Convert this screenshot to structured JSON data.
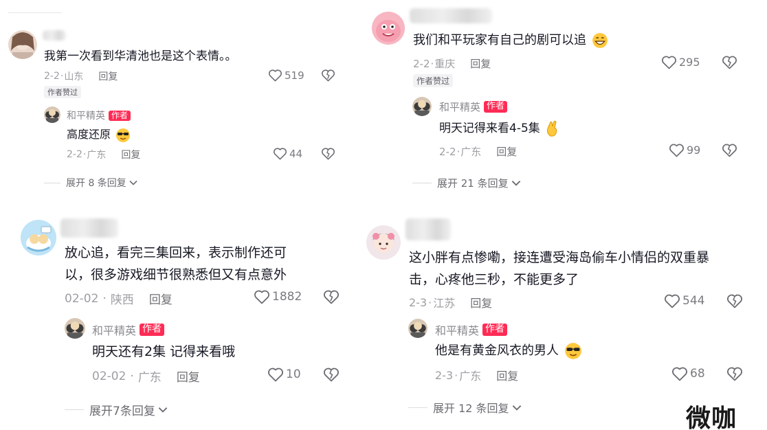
{
  "comments": [
    {
      "text_lines": [
        "我第一次看到华清池也是这个表情。。"
      ],
      "date": "2-2",
      "sep": "·",
      "location": "山东",
      "reply_label": "回复",
      "likes": "519",
      "tag": "作者赞过",
      "reply": {
        "name": "和平精英",
        "badge": "作者",
        "text": "高度还原",
        "date": "2-2",
        "sep": "·",
        "location": "广东",
        "reply_label": "回复",
        "likes": "44"
      },
      "expand": "展开 8 条回复"
    },
    {
      "text_lines": [
        "我们和平玩家有自己的剧可以追"
      ],
      "date": "2-2",
      "sep": "·",
      "location": "重庆",
      "reply_label": "回复",
      "likes": "295",
      "tag": "作者赞过",
      "reply": {
        "name": "和平精英",
        "badge": "作者",
        "text": "明天记得来看4-5集",
        "date": "2-2",
        "sep": "·",
        "location": "广东",
        "reply_label": "回复",
        "likes": "99"
      },
      "expand": "展开 21 条回复"
    },
    {
      "text_lines": [
        "放心追，看完三集回来，表示制作还可",
        "以，很多游戏细节很熟悉但又有点意外"
      ],
      "date": "02-02",
      "sep": "·",
      "location": "陕西",
      "reply_label": "回复",
      "likes": "1882",
      "reply": {
        "name": "和平精英",
        "badge": "作者",
        "text": "明天还有2集 记得来看哦",
        "date": "02-02",
        "sep": "·",
        "location": "广东",
        "reply_label": "回复",
        "likes": "10"
      },
      "expand": "展开7条回复"
    },
    {
      "text_lines": [
        "这小胖有点惨嘞，接连遭受海岛偷车小情侣的双重暴",
        "击，心疼他三秒，不能更多了"
      ],
      "date": "2-3",
      "sep": "·",
      "location": "江苏",
      "reply_label": "回复",
      "likes": "544",
      "reply": {
        "name": "和平精英",
        "badge": "作者",
        "text": "他是有黄金风衣的男人",
        "date": "2-3",
        "sep": "·",
        "location": "广东",
        "reply_label": "回复",
        "likes": "68"
      },
      "expand": "展开 12 条回复"
    }
  ],
  "watermark": "微咖",
  "colors": {
    "author_badge": "#fe2c55",
    "meta": "#9e9ea3",
    "watermark_accent": "#f5a623"
  },
  "icons": {
    "like": "heart-outline-icon",
    "dislike": "broken-heart-icon",
    "expand": "chevron-down-icon"
  }
}
